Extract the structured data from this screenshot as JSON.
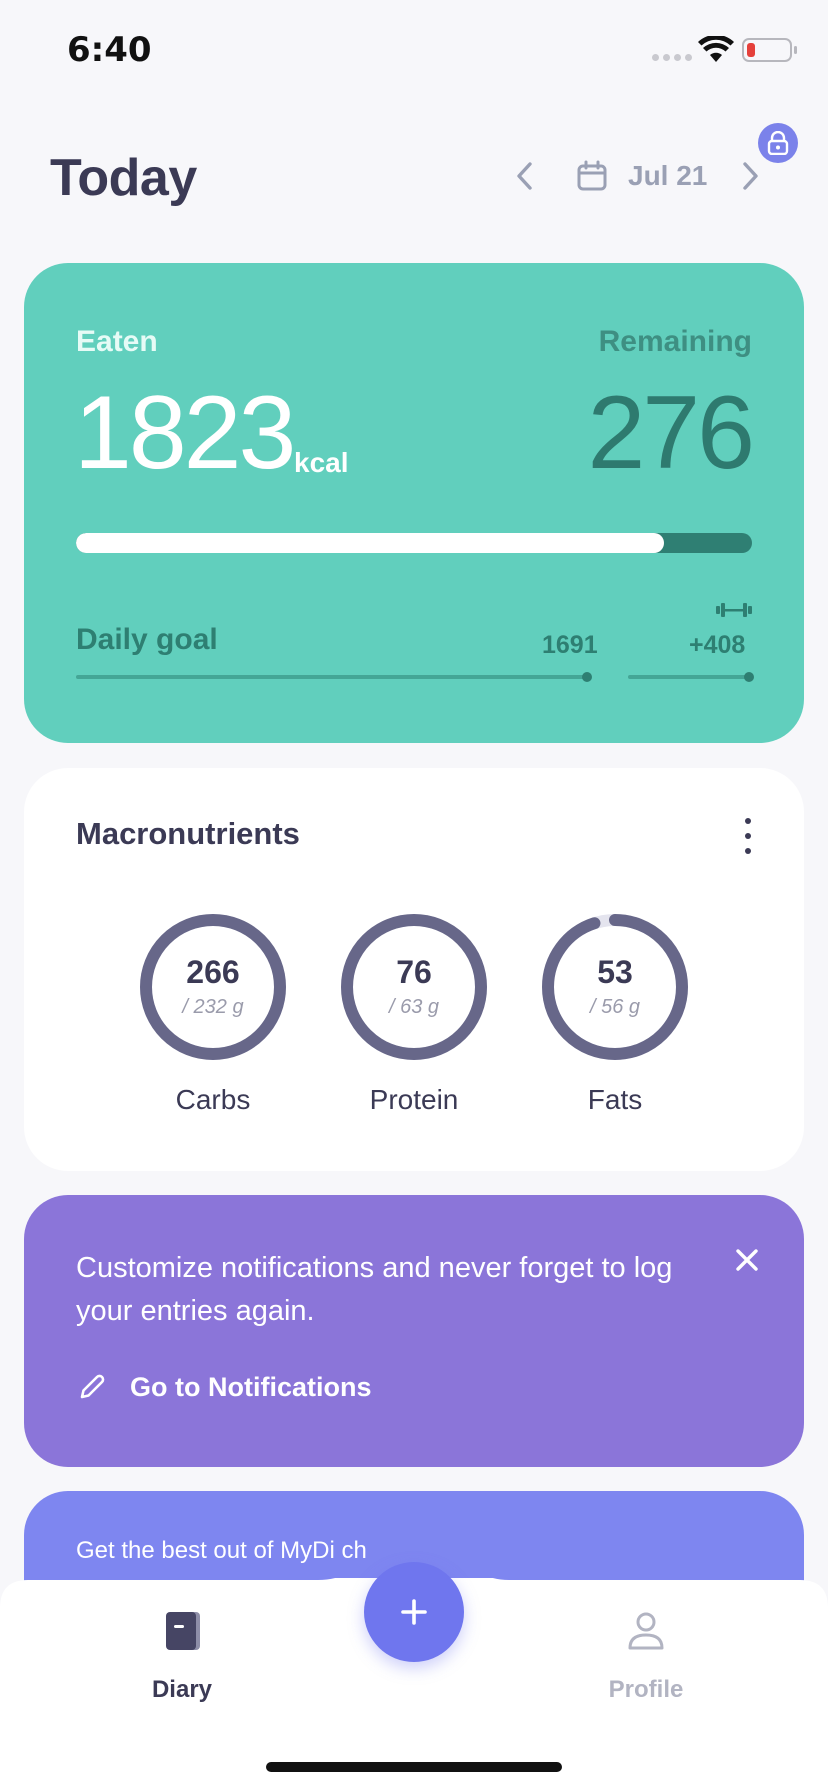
{
  "status_bar": {
    "time": "6:40"
  },
  "header": {
    "title": "Today",
    "date": "Jul 21"
  },
  "calories": {
    "eaten_label": "Eaten",
    "eaten_value": "1823",
    "unit": "kcal",
    "remaining_label": "Remaining",
    "remaining_value": "276",
    "progress_fraction": 0.87,
    "goal_label": "Daily goal",
    "goal_value": "1691",
    "exercise_bonus": "+408",
    "colors": {
      "card": "#61cfbd",
      "track": "#2f7f73",
      "fill": "#ffffff"
    }
  },
  "macros": {
    "title": "Macronutrients",
    "items": [
      {
        "label": "Carbs",
        "value": "266",
        "target": "/ 232 g",
        "fraction": 1.0
      },
      {
        "label": "Protein",
        "value": "76",
        "target": "/ 63 g",
        "fraction": 1.0
      },
      {
        "label": "Fats",
        "value": "53",
        "target": "/ 56 g",
        "fraction": 0.95
      }
    ],
    "ring_color": "#676789",
    "ring_track_color": "#e4e4ee"
  },
  "notification": {
    "text": "Customize notifications and never forget to log your entries again.",
    "link": "Go to Notifications",
    "color": "#8b75d9"
  },
  "promo": {
    "text": "Get the best out of MyDi  ch",
    "color": "#7e86f0"
  },
  "tab_bar": {
    "items": [
      {
        "label": "Diary",
        "icon": "diary-icon",
        "active": true
      },
      {
        "label": "Profile",
        "icon": "profile-icon",
        "active": false
      }
    ],
    "add_icon": "plus-icon",
    "accent": "#6f76ee"
  }
}
